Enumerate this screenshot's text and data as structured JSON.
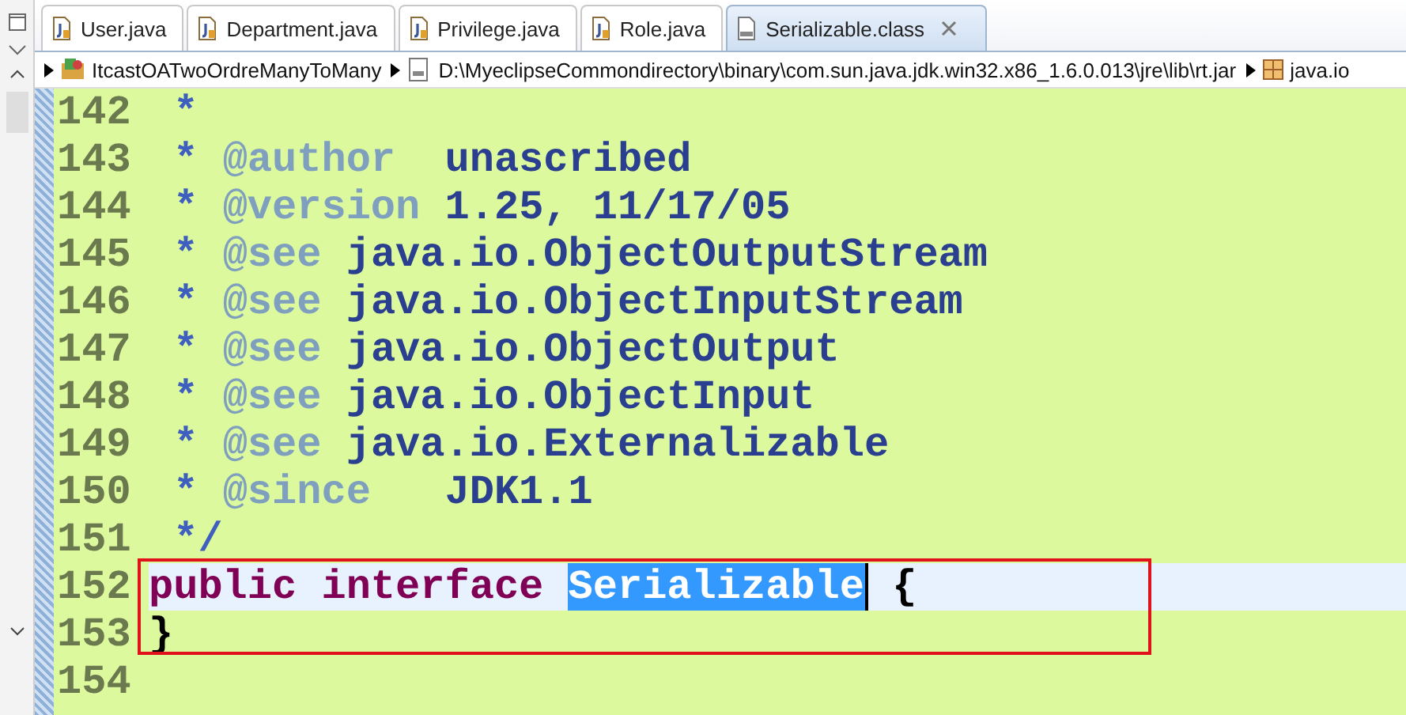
{
  "tabs": [
    {
      "label": "User.java",
      "kind": "java",
      "selected": false,
      "closable": false
    },
    {
      "label": "Department.java",
      "kind": "java",
      "selected": false,
      "closable": false
    },
    {
      "label": "Privilege.java",
      "kind": "java",
      "selected": false,
      "closable": false
    },
    {
      "label": "Role.java",
      "kind": "java",
      "selected": false,
      "closable": false
    },
    {
      "label": "Serializable.class",
      "kind": "class",
      "selected": true,
      "closable": true
    }
  ],
  "breadcrumb": [
    {
      "label": "ItcastOATwoOrdreManyToMany",
      "kind": "project"
    },
    {
      "label": "D:\\MyeclipseCommondirectory\\binary\\com.sun.java.jdk.win32.x86_1.6.0.013\\jre\\lib\\rt.jar",
      "kind": "jar"
    },
    {
      "label": "java.io",
      "kind": "package"
    }
  ],
  "lines": [
    {
      "number": "142",
      "current": false,
      "boxed": false,
      "tokens": [
        {
          "text": " *",
          "kind": "star"
        }
      ]
    },
    {
      "number": "143",
      "current": false,
      "boxed": false,
      "tokens": [
        {
          "text": " *",
          "kind": "star"
        },
        {
          "text": " @author",
          "kind": "tag"
        },
        {
          "text": "  unascribed",
          "kind": "doc"
        }
      ]
    },
    {
      "number": "144",
      "current": false,
      "boxed": false,
      "tokens": [
        {
          "text": " *",
          "kind": "star"
        },
        {
          "text": " @version",
          "kind": "tag"
        },
        {
          "text": " 1.25, 11/17/05",
          "kind": "doc"
        }
      ]
    },
    {
      "number": "145",
      "current": false,
      "boxed": false,
      "tokens": [
        {
          "text": " *",
          "kind": "star"
        },
        {
          "text": " @see",
          "kind": "tag"
        },
        {
          "text": " java.io.ObjectOutputStream",
          "kind": "doc"
        }
      ]
    },
    {
      "number": "146",
      "current": false,
      "boxed": false,
      "tokens": [
        {
          "text": " *",
          "kind": "star"
        },
        {
          "text": " @see",
          "kind": "tag"
        },
        {
          "text": " java.io.ObjectInputStream",
          "kind": "doc"
        }
      ]
    },
    {
      "number": "147",
      "current": false,
      "boxed": false,
      "tokens": [
        {
          "text": " *",
          "kind": "star"
        },
        {
          "text": " @see",
          "kind": "tag"
        },
        {
          "text": " java.io.ObjectOutput",
          "kind": "doc"
        }
      ]
    },
    {
      "number": "148",
      "current": false,
      "boxed": false,
      "tokens": [
        {
          "text": " *",
          "kind": "star"
        },
        {
          "text": " @see",
          "kind": "tag"
        },
        {
          "text": " java.io.ObjectInput",
          "kind": "doc"
        }
      ]
    },
    {
      "number": "149",
      "current": false,
      "boxed": false,
      "tokens": [
        {
          "text": " *",
          "kind": "star"
        },
        {
          "text": " @see",
          "kind": "tag"
        },
        {
          "text": " java.io.Externalizable",
          "kind": "doc"
        }
      ]
    },
    {
      "number": "150",
      "current": false,
      "boxed": false,
      "tokens": [
        {
          "text": " *",
          "kind": "star"
        },
        {
          "text": " @since",
          "kind": "tag"
        },
        {
          "text": "   JDK1.1",
          "kind": "doc"
        }
      ]
    },
    {
      "number": "151",
      "current": false,
      "boxed": false,
      "tokens": [
        {
          "text": " */",
          "kind": "star"
        }
      ]
    },
    {
      "number": "152",
      "current": true,
      "boxed": true,
      "tokens": [
        {
          "text": "public",
          "kind": "keyword"
        },
        {
          "text": " interface ",
          "kind": "keyword"
        },
        {
          "text": "Serializable",
          "kind": "selection"
        },
        {
          "text": " {",
          "kind": "plain"
        }
      ]
    },
    {
      "number": "153",
      "current": false,
      "boxed": true,
      "tokens": [
        {
          "text": "}",
          "kind": "plain"
        }
      ]
    },
    {
      "number": "154",
      "current": false,
      "boxed": false
    }
  ]
}
